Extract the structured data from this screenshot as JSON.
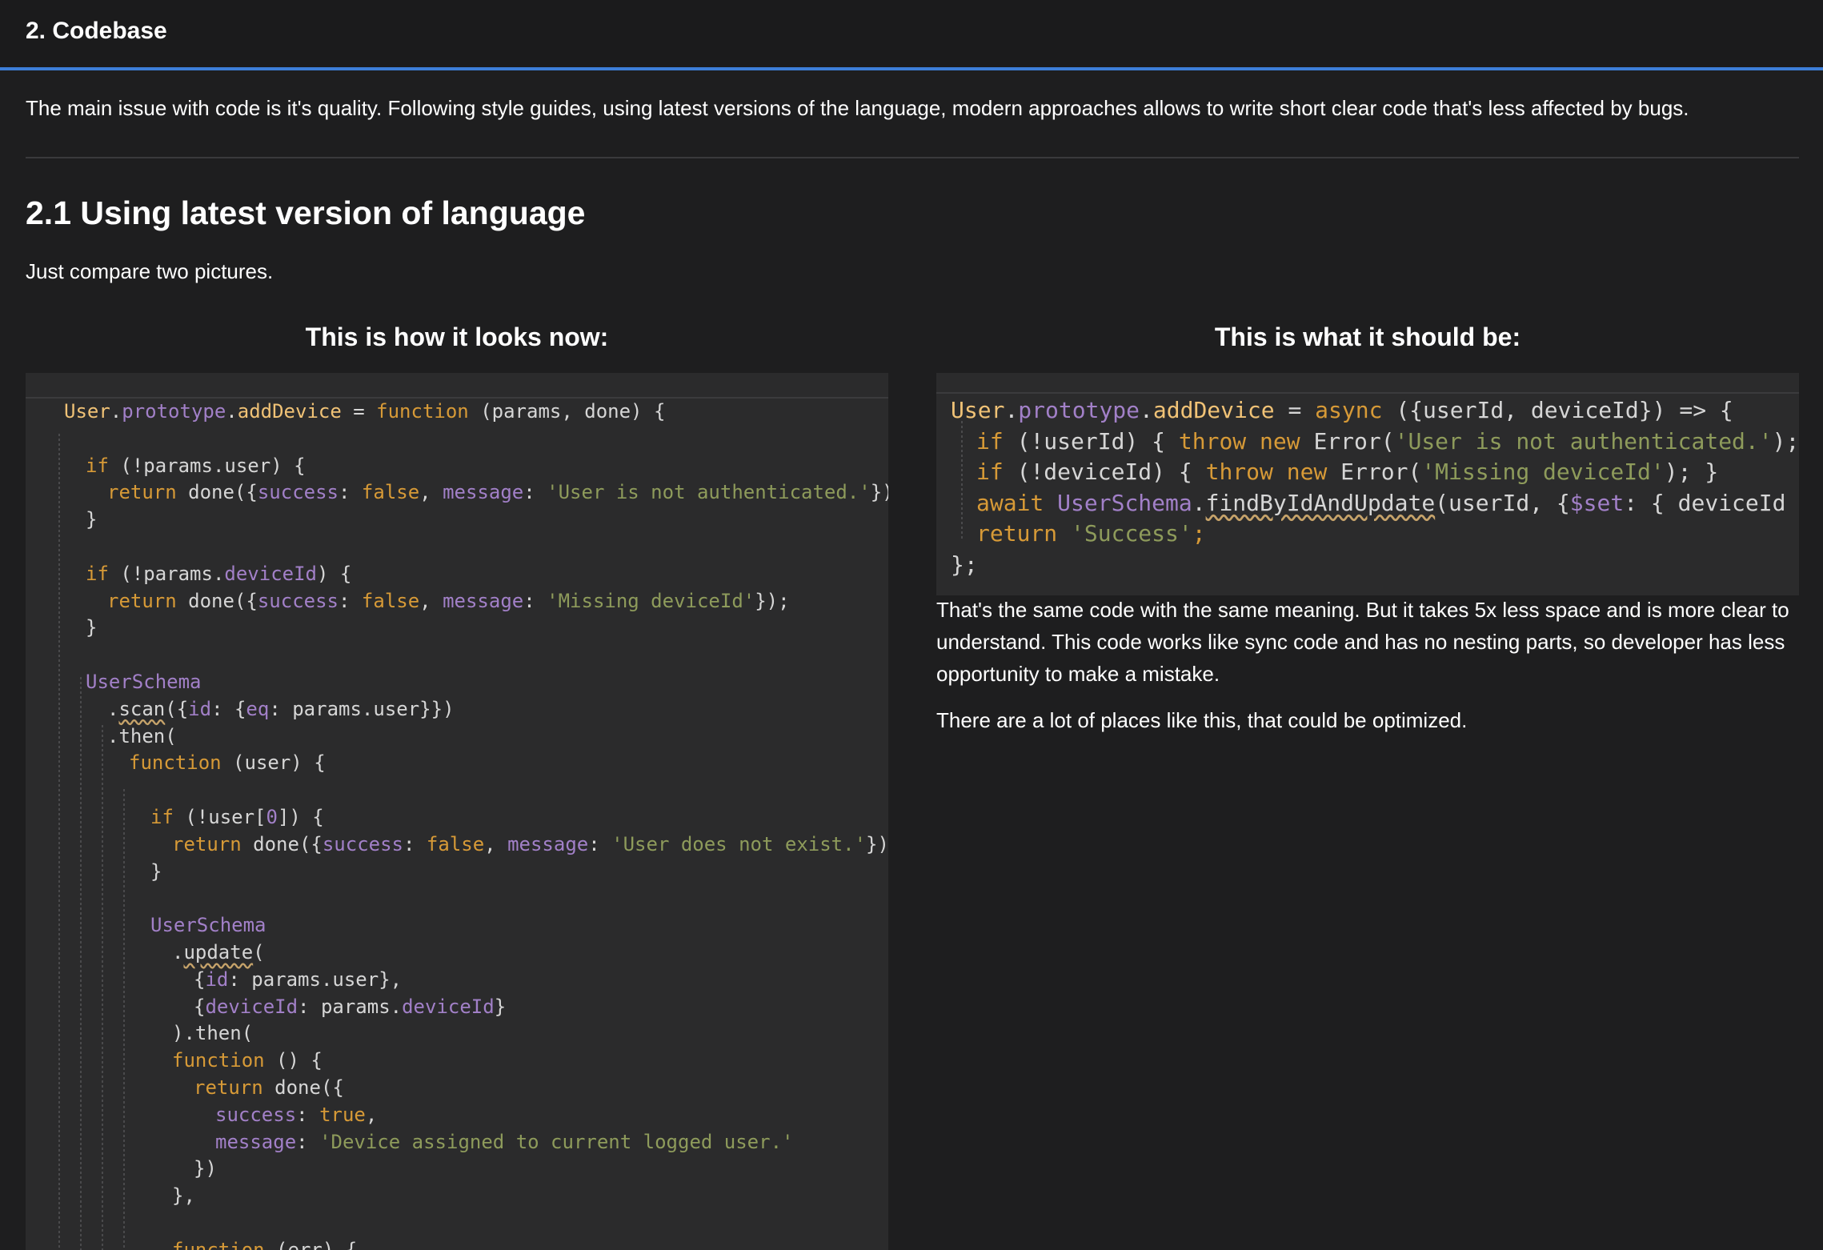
{
  "header": {
    "title": "2. Codebase"
  },
  "intro": "The main issue with code is it's quality. Following style guides, using latest versions of the language, modern approaches allows to write short clear code that's less affected by bugs.",
  "section": {
    "heading": "2.1 Using latest version of language",
    "subtitle": "Just compare two pictures."
  },
  "left_column": {
    "heading": "This is how it looks now:",
    "code": [
      [
        {
          "t": "User",
          "c": "f"
        },
        {
          "t": ".",
          "c": "t"
        },
        {
          "t": "prototype",
          "c": "p"
        },
        {
          "t": ".",
          "c": "t"
        },
        {
          "t": "addDevice",
          "c": "f"
        },
        {
          "t": " = ",
          "c": "t"
        },
        {
          "t": "function",
          "c": "k"
        },
        {
          "t": " (params, done) {",
          "c": "t"
        }
      ],
      [],
      [
        {
          "t": "if",
          "c": "k"
        },
        {
          "t": " (!params.user) {",
          "c": "t"
        }
      ],
      [
        {
          "t": "return",
          "c": "k"
        },
        {
          "t": " done({",
          "c": "t"
        },
        {
          "t": "success",
          "c": "p"
        },
        {
          "t": ": ",
          "c": "t"
        },
        {
          "t": "false",
          "c": "k"
        },
        {
          "t": ", ",
          "c": "t"
        },
        {
          "t": "message",
          "c": "p"
        },
        {
          "t": ": ",
          "c": "t"
        },
        {
          "t": "'User is not authenticated.'",
          "c": "s"
        },
        {
          "t": "});",
          "c": "t"
        }
      ],
      [
        {
          "t": "}",
          "c": "t"
        }
      ],
      [],
      [
        {
          "t": "if",
          "c": "k"
        },
        {
          "t": " (!params.",
          "c": "t"
        },
        {
          "t": "deviceId",
          "c": "p"
        },
        {
          "t": ") {",
          "c": "t"
        }
      ],
      [
        {
          "t": "return",
          "c": "k"
        },
        {
          "t": " done({",
          "c": "t"
        },
        {
          "t": "success",
          "c": "p"
        },
        {
          "t": ": ",
          "c": "t"
        },
        {
          "t": "false",
          "c": "k"
        },
        {
          "t": ", ",
          "c": "t"
        },
        {
          "t": "message",
          "c": "p"
        },
        {
          "t": ": ",
          "c": "t"
        },
        {
          "t": "'Missing deviceId'",
          "c": "s"
        },
        {
          "t": "});",
          "c": "t"
        }
      ],
      [
        {
          "t": "}",
          "c": "t"
        }
      ],
      [],
      [
        {
          "t": "UserSchema",
          "c": "p"
        }
      ],
      [
        {
          "t": ".",
          "c": "t"
        },
        {
          "t": "scan",
          "c": "t",
          "u": true
        },
        {
          "t": "({",
          "c": "t"
        },
        {
          "t": "id",
          "c": "p"
        },
        {
          "t": ": {",
          "c": "t"
        },
        {
          "t": "eq",
          "c": "p"
        },
        {
          "t": ": params.user}})",
          "c": "t"
        }
      ],
      [
        {
          "t": ".then(",
          "c": "t"
        }
      ],
      [
        {
          "t": "function",
          "c": "k"
        },
        {
          "t": " (user) {",
          "c": "t"
        }
      ],
      [],
      [
        {
          "t": "if",
          "c": "k"
        },
        {
          "t": " (!user[",
          "c": "t"
        },
        {
          "t": "0",
          "c": "p"
        },
        {
          "t": "]) {",
          "c": "t"
        }
      ],
      [
        {
          "t": "return",
          "c": "k"
        },
        {
          "t": " done({",
          "c": "t"
        },
        {
          "t": "success",
          "c": "p"
        },
        {
          "t": ": ",
          "c": "t"
        },
        {
          "t": "false",
          "c": "k"
        },
        {
          "t": ", ",
          "c": "t"
        },
        {
          "t": "message",
          "c": "p"
        },
        {
          "t": ": ",
          "c": "t"
        },
        {
          "t": "'User does not exist.'",
          "c": "s"
        },
        {
          "t": "});",
          "c": "t"
        }
      ],
      [
        {
          "t": "}",
          "c": "t"
        }
      ],
      [],
      [
        {
          "t": "UserSchema",
          "c": "p"
        }
      ],
      [
        {
          "t": ".",
          "c": "t"
        },
        {
          "t": "update",
          "c": "t",
          "u": true
        },
        {
          "t": "(",
          "c": "t"
        }
      ],
      [
        {
          "t": "{",
          "c": "t"
        },
        {
          "t": "id",
          "c": "p"
        },
        {
          "t": ": params.user},",
          "c": "t"
        }
      ],
      [
        {
          "t": "{",
          "c": "t"
        },
        {
          "t": "deviceId",
          "c": "p"
        },
        {
          "t": ": params.",
          "c": "t"
        },
        {
          "t": "deviceId",
          "c": "p"
        },
        {
          "t": "}",
          "c": "t"
        }
      ],
      [
        {
          "t": ").then(",
          "c": "t"
        }
      ],
      [
        {
          "t": "function",
          "c": "k"
        },
        {
          "t": " () {",
          "c": "t"
        }
      ],
      [
        {
          "t": "return",
          "c": "k"
        },
        {
          "t": " done({",
          "c": "t"
        }
      ],
      [
        {
          "t": "success",
          "c": "p"
        },
        {
          "t": ": ",
          "c": "t"
        },
        {
          "t": "true",
          "c": "k"
        },
        {
          "t": ",",
          "c": "t"
        }
      ],
      [
        {
          "t": "message",
          "c": "p"
        },
        {
          "t": ": ",
          "c": "t"
        },
        {
          "t": "'Device assigned to current logged user.'",
          "c": "s"
        }
      ],
      [
        {
          "t": "})",
          "c": "t"
        }
      ],
      [
        {
          "t": "},",
          "c": "t"
        }
      ],
      [],
      [
        {
          "t": "function",
          "c": "k"
        },
        {
          "t": " (err) {",
          "c": "t"
        }
      ]
    ]
  },
  "right_column": {
    "heading": "This is what it should be:",
    "code": [
      [
        {
          "t": "User",
          "c": "f"
        },
        {
          "t": ".",
          "c": "t"
        },
        {
          "t": "prototype",
          "c": "p"
        },
        {
          "t": ".",
          "c": "t"
        },
        {
          "t": "addDevice",
          "c": "f"
        },
        {
          "t": " = ",
          "c": "t"
        },
        {
          "t": "async",
          "c": "k"
        },
        {
          "t": " ({userId, deviceId}) => {",
          "c": "t"
        }
      ],
      [
        {
          "t": "if",
          "c": "k"
        },
        {
          "t": " (!userId) { ",
          "c": "t"
        },
        {
          "t": "throw new",
          "c": "k"
        },
        {
          "t": " Error(",
          "c": "t"
        },
        {
          "t": "'User is not authenticated.'",
          "c": "s"
        },
        {
          "t": "); }",
          "c": "t"
        }
      ],
      [
        {
          "t": "if",
          "c": "k"
        },
        {
          "t": " (!deviceId) { ",
          "c": "t"
        },
        {
          "t": "throw new",
          "c": "k"
        },
        {
          "t": " Error(",
          "c": "t"
        },
        {
          "t": "'Missing deviceId'",
          "c": "s"
        },
        {
          "t": "); }",
          "c": "t"
        }
      ],
      [
        {
          "t": "await",
          "c": "k"
        },
        {
          "t": " ",
          "c": "t"
        },
        {
          "t": "UserSchema",
          "c": "p"
        },
        {
          "t": ".",
          "c": "t"
        },
        {
          "t": "findByIdAndUpdate",
          "c": "t",
          "u": true
        },
        {
          "t": "(userId, {",
          "c": "t"
        },
        {
          "t": "$set",
          "c": "p"
        },
        {
          "t": ": { deviceId }});",
          "c": "t"
        }
      ],
      [
        {
          "t": "return",
          "c": "k"
        },
        {
          "t": " ",
          "c": "t"
        },
        {
          "t": "'Success'",
          "c": "s"
        },
        {
          "t": ";",
          "c": "k"
        }
      ],
      [
        {
          "t": "};",
          "c": "t"
        }
      ]
    ],
    "paragraph_1": "That's the same code with the same meaning. But it takes 5x less space and is more clear to understand. This code works like sync code and has no nesting parts, so developer has less opportunity to make a mistake.",
    "paragraph_2": "There are a lot of places like this, that could be optimized."
  }
}
